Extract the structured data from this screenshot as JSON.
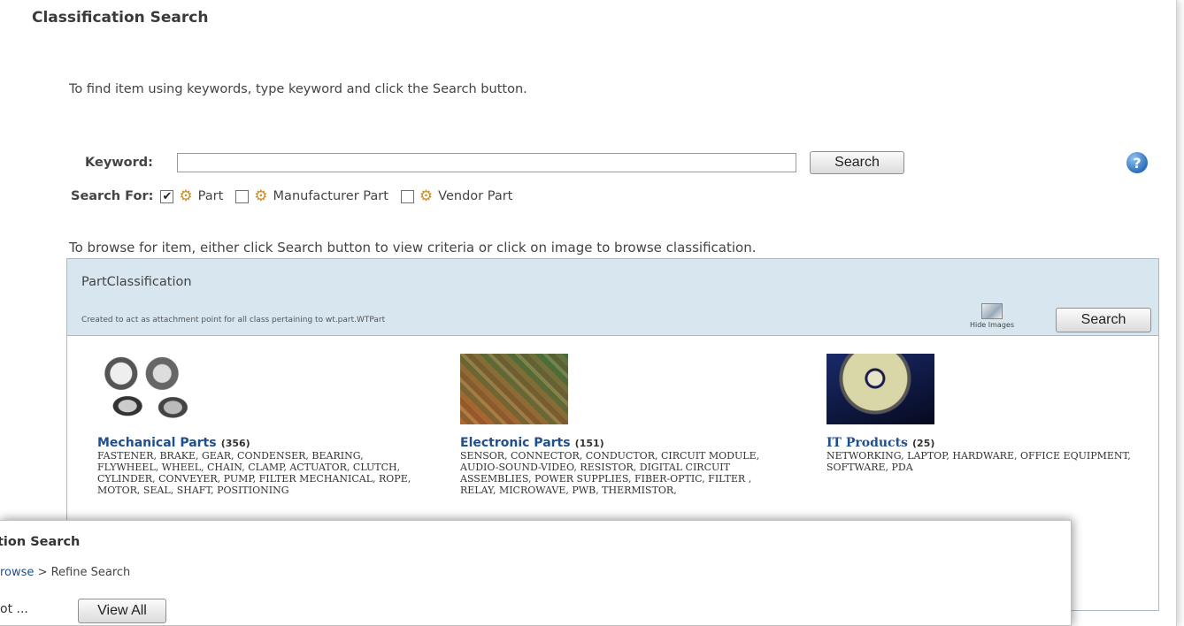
{
  "main": {
    "title": "Classification Search",
    "intro": "To find item using keywords, type keyword and click the Search button.",
    "keyword": {
      "label": "Keyword:",
      "value": "",
      "search_label": "Search"
    },
    "help_icon": "help-icon",
    "search_for": {
      "label": "Search For:",
      "options": [
        {
          "label": "Part",
          "checked": true,
          "icon": "gear-icon"
        },
        {
          "label": "Manufacturer Part",
          "checked": false,
          "icon": "gear-icon"
        },
        {
          "label": "Vendor Part",
          "checked": false,
          "icon": "gear-icon"
        }
      ]
    },
    "browse_text": "To browse for item, either click Search button to view criteria or click on image to browse classification.",
    "classification": {
      "name": "PartClassification",
      "description": "Created to act as attachment point for all class pertaining to wt.part.WTPart",
      "hide_images_label": "Hide Images",
      "search_label": "Search",
      "categories": [
        {
          "title": "Mechanical Parts",
          "count": "(356)",
          "description": "FASTENER, BRAKE, GEAR, CONDENSER, BEARING, FLYWHEEL, WHEEL, CHAIN, CLAMP, ACTUATOR, CLUTCH, CYLINDER, CONVEYER, PUMP, FILTER MECHANICAL, ROPE, MOTOR, SEAL, SHAFT, POSITIONING"
        },
        {
          "title": "Electronic Parts",
          "count": "(151)",
          "description": "SENSOR, CONNECTOR, CONDUCTOR, CIRCUIT MODULE, AUDIO-SOUND-VIDEO, RESISTOR, DIGITAL CIRCUIT ASSEMBLIES, POWER SUPPLIES, FIBER-OPTIC, FILTER , RELAY, MICROWAVE, PWB, THERMISTOR,"
        },
        {
          "title": "IT Products",
          "count": "(25)",
          "description": "NETWORKING, LAPTOP, HARDWARE, OFFICE EQUIPMENT, SOFTWARE, PDA"
        }
      ]
    }
  },
  "overlay": {
    "title": "tion Search",
    "breadcrumb_link": "rowse",
    "breadcrumb_separator": ">",
    "breadcrumb_current": "Refine Search",
    "label": "ot  ...  ",
    "view_all_label": "View All"
  }
}
